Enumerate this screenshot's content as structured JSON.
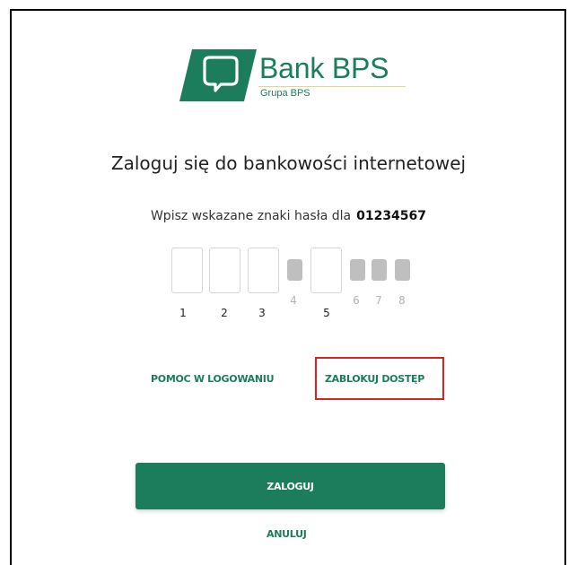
{
  "brand": {
    "name": "Bank BPS",
    "subtitle": "Grupa BPS",
    "logo_icon": "bank-bps-logo-mark",
    "color": "#1b7d5b"
  },
  "login": {
    "title": "Zaloguj się do bankowości internetowej",
    "instruction": "Wpisz wskazane znaki hasła dla",
    "client_number": "01234567"
  },
  "password_positions": [
    {
      "label": "1",
      "active": true
    },
    {
      "label": "2",
      "active": true
    },
    {
      "label": "3",
      "active": true
    },
    {
      "label": "4",
      "active": false
    },
    {
      "label": "5",
      "active": true
    },
    {
      "label": "6",
      "active": false
    },
    {
      "label": "7",
      "active": false
    },
    {
      "label": "8",
      "active": false
    }
  ],
  "links": {
    "help": "POMOC W LOGOWANIU",
    "block": "ZABLOKUJ DOSTĘP"
  },
  "actions": {
    "login": "ZALOGUJ",
    "cancel": "ANULUJ"
  },
  "colors": {
    "accent": "#1b7d5b",
    "highlight": "#e02020",
    "inactive_slot": "#bfbfbf"
  }
}
